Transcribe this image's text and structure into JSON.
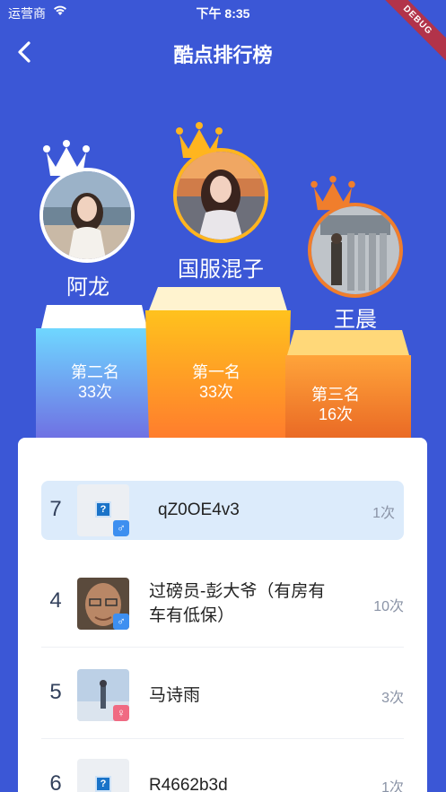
{
  "status_bar": {
    "carrier": "运营商",
    "time": "下午 8:35"
  },
  "debug_banner": "DEBUG",
  "nav": {
    "title": "酷点排行榜"
  },
  "podium": {
    "first": {
      "name": "国服混子",
      "place_label": "第一名",
      "count": "33次"
    },
    "second": {
      "name": "阿龙",
      "place_label": "第二名",
      "count": "33次"
    },
    "third": {
      "name": "王晨",
      "place_label": "第三名",
      "count": "16次"
    }
  },
  "ranking": [
    {
      "rank": "7",
      "name": "qZ0OE4v3",
      "count": "1次",
      "gender": "♂",
      "highlighted": true
    },
    {
      "rank": "4",
      "name_line1": "过磅员-彭大爷（有房有",
      "name_line2": "车有低保）",
      "count": "10次",
      "gender": "♂"
    },
    {
      "rank": "5",
      "name": "马诗雨",
      "count": "3次",
      "gender": "♀"
    },
    {
      "rank": "6",
      "name": "R4662b3d",
      "count": "1次",
      "gender": "♂"
    }
  ],
  "colors": {
    "background": "#3b57d6",
    "highlight_row": "#dcebfb",
    "first_block": "#ff9f1c",
    "second_block": "#6aa8f0",
    "third_block": "#f08a2c"
  }
}
